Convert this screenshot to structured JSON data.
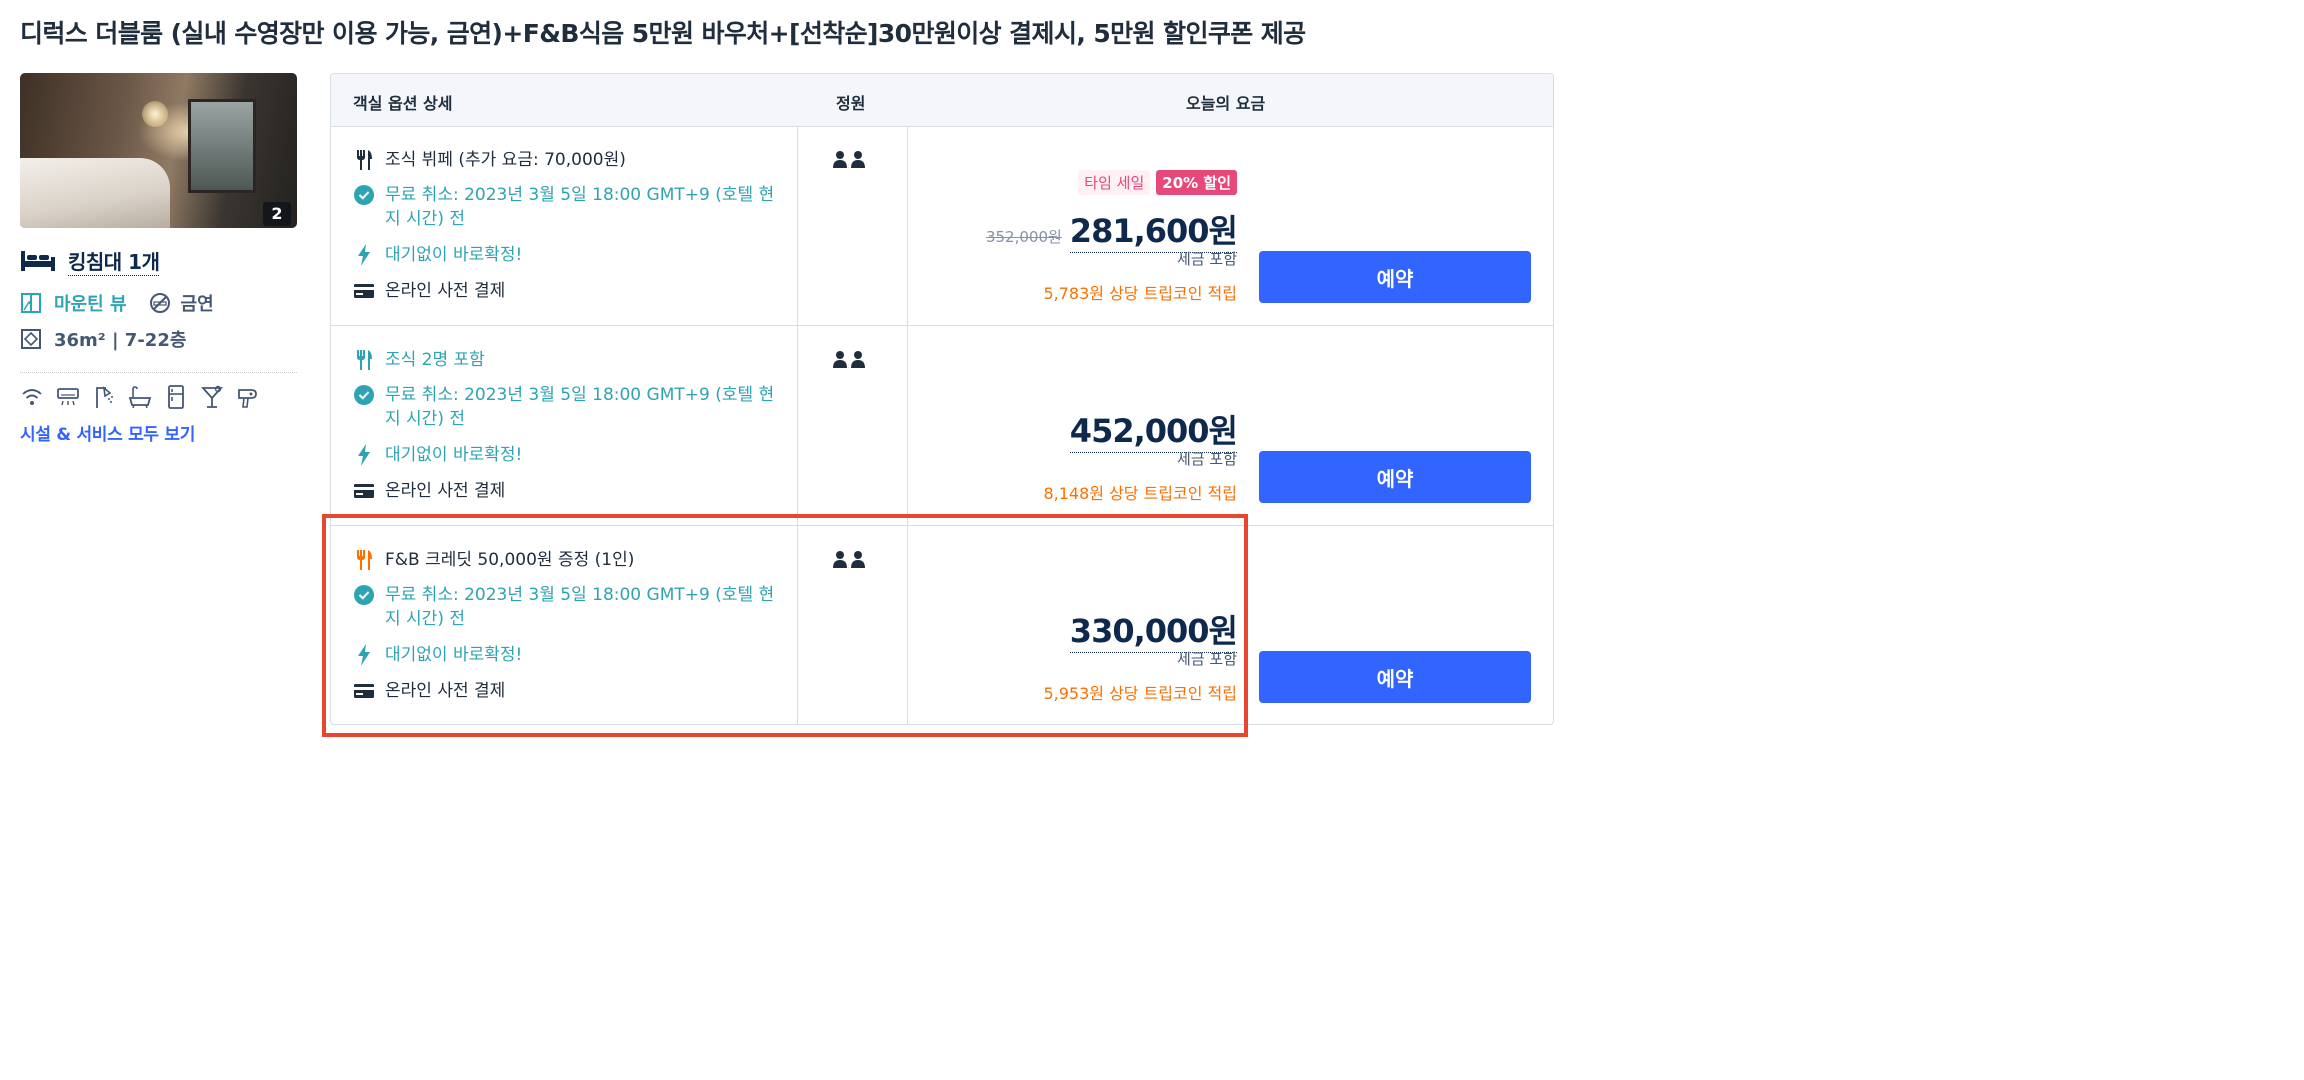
{
  "room": {
    "title": "디럭스 더블룸 (실내 수영장만 이용 가능, 금연)+F&B식음 5만원 바우처+[선착순]30만원이상 결제시, 5만원 할인쿠폰 제공",
    "photo_count": "2",
    "bed": "킹침대 1개",
    "view": "마운틴 뷰",
    "smoking": "금연",
    "size": "36m² | 7-22층",
    "amenities": [
      "wifi-icon",
      "ac-icon",
      "shower-icon",
      "bathtub-icon",
      "fridge-icon",
      "minibar-icon",
      "hairdryer-icon"
    ],
    "all_facilities_link": "시설 & 서비스 모두 보기"
  },
  "table": {
    "headers": {
      "options": "객실 옵션 상세",
      "capacity": "정원",
      "price": "오늘의 요금"
    },
    "rows": [
      {
        "meal": "조식 뷔페 (추가 요금: 70,000원)",
        "meal_color": "dark",
        "cancel": "무료 취소: 2023년 3월 5일 18:00 GMT+9 (호텔 현지 시간) 전",
        "instant": "대기없이 바로확정!",
        "payment": "온라인 사전 결제",
        "tag_sale": "타임 세일",
        "tag_discount": "20% 할인",
        "old_price": "352,000원",
        "price": "281,600원",
        "tax": "세금 포함",
        "coins": "5,783원 상당 트립코인 적립",
        "book": "예약"
      },
      {
        "meal": "조식 2명 포함",
        "meal_color": "teal",
        "cancel": "무료 취소: 2023년 3월 5일 18:00 GMT+9 (호텔 현지 시간) 전",
        "instant": "대기없이 바로확정!",
        "payment": "온라인 사전 결제",
        "price": "452,000원",
        "tax": "세금 포함",
        "coins": "8,148원 상당 트립코인 적립",
        "book": "예약"
      },
      {
        "meal": "F&B 크레딧 50,000원 증정 (1인)",
        "meal_color": "orange",
        "cancel": "무료 취소: 2023년 3월 5일 18:00 GMT+9 (호텔 현지 시간) 전",
        "instant": "대기없이 바로확정!",
        "payment": "온라인 사전 결제",
        "price": "330,000원",
        "tax": "세금 포함",
        "coins": "5,953원 상당 트립코인 적립",
        "book": "예약"
      }
    ]
  },
  "colors": {
    "accent": "#3264ff",
    "teal": "#2ea4b3",
    "orange": "#ff6f00",
    "pink": "#e6487a",
    "highlight": "#e8472f"
  }
}
